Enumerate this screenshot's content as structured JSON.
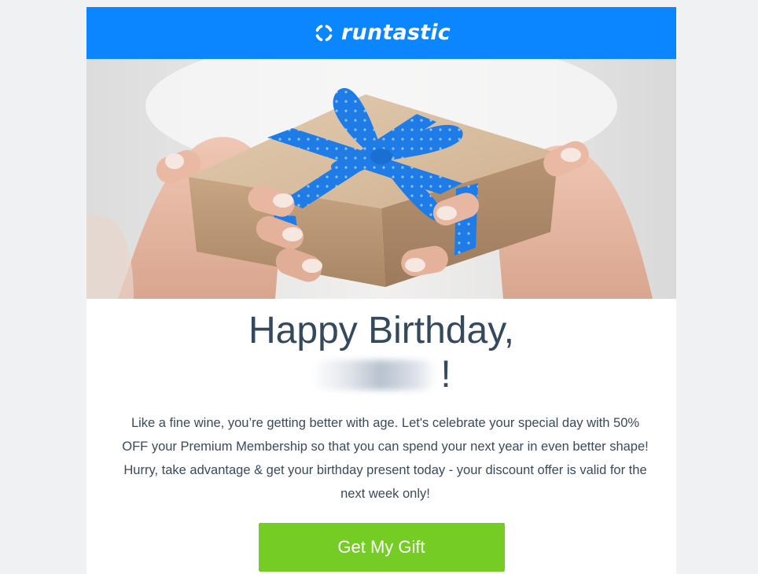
{
  "brand": {
    "name": "runtastic",
    "header_color": "#0b86ff"
  },
  "hero": {
    "image": "gift-box-in-hands",
    "ribbon_color": "#1f7be6"
  },
  "greeting": {
    "headline": "Happy Birthday,",
    "name_suffix": "!"
  },
  "body": {
    "message": "Like a fine wine, you’re getting better with age. Let's celebrate your special day with 50% OFF your Premium Membership so that you can spend your next year in even better shape! Hurry, take advantage & get your birthday present today - your discount offer is valid for the next week only!"
  },
  "cta": {
    "label": "Get My Gift",
    "color": "#74cc25"
  }
}
